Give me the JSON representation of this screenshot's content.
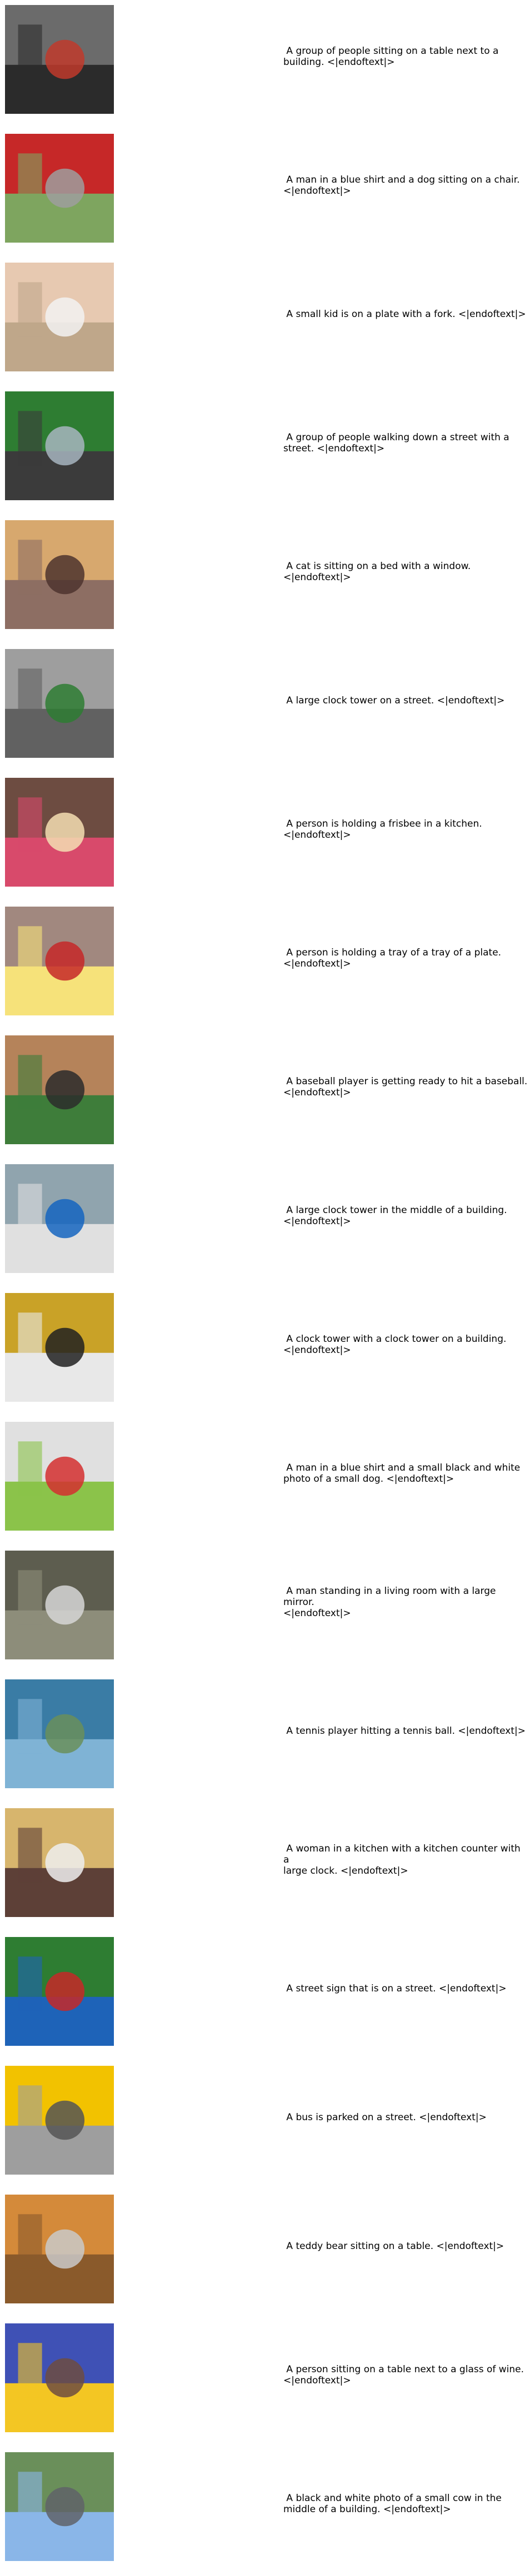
{
  "items": [
    {
      "caption": " A group of people sitting on a table next to a\nbuilding. <|endoftext|>",
      "photo": {
        "type": "image",
        "palette": [
          "#2b2b2b",
          "#6b6b6b",
          "#c0392b"
        ]
      }
    },
    {
      "caption": " A man in a blue shirt and a dog sitting on a chair.\n<|endoftext|>",
      "photo": {
        "type": "image",
        "palette": [
          "#7ea55f",
          "#c62828",
          "#9e9e9e"
        ]
      }
    },
    {
      "caption": " A small kid is on a plate with a fork. <|endoftext|>",
      "photo": {
        "type": "image",
        "palette": [
          "#bfa78a",
          "#e7c9b1",
          "#f2f2f2"
        ]
      }
    },
    {
      "caption": " A group of people walking down a street with a\nstreet. <|endoftext|>",
      "photo": {
        "type": "image",
        "palette": [
          "#3b3b3b",
          "#2e7d32",
          "#a7b5c0"
        ]
      }
    },
    {
      "caption": " A cat is sitting on a bed with a window.\n<|endoftext|>",
      "photo": {
        "type": "image",
        "palette": [
          "#8d6e63",
          "#d7a86e",
          "#4e342e"
        ]
      }
    },
    {
      "caption": " A large clock tower on a street. <|endoftext|>",
      "photo": {
        "type": "image",
        "palette": [
          "#616161",
          "#9e9e9e",
          "#2e7d32"
        ]
      }
    },
    {
      "caption": " A person is holding a frisbee in a kitchen.\n<|endoftext|>",
      "photo": {
        "type": "image",
        "palette": [
          "#d84a6b",
          "#6d4c41",
          "#f5deb3"
        ]
      }
    },
    {
      "caption": " A person is holding a tray of a tray of a plate.\n<|endoftext|>",
      "photo": {
        "type": "image",
        "palette": [
          "#f6e27a",
          "#a1887f",
          "#c62828"
        ]
      }
    },
    {
      "caption": " A baseball player is getting ready to hit a baseball.\n<|endoftext|>",
      "photo": {
        "type": "image",
        "palette": [
          "#3e7d3a",
          "#b5835a",
          "#2b2b2b"
        ]
      }
    },
    {
      "caption": " A large clock tower in the middle of a building.\n<|endoftext|>",
      "photo": {
        "type": "image",
        "palette": [
          "#e0e0e0",
          "#90a4ae",
          "#1565c0"
        ]
      }
    },
    {
      "caption": " A clock tower with a clock tower on a building.\n<|endoftext|>",
      "photo": {
        "type": "image",
        "palette": [
          "#e8e8e8",
          "#c9a227",
          "#212121"
        ]
      }
    },
    {
      "caption": " A man in a blue shirt and a small black and white\nphoto of a small dog. <|endoftext|>",
      "photo": {
        "type": "image",
        "palette": [
          "#8bc34a",
          "#e0e0e0",
          "#d32f2f"
        ]
      }
    },
    {
      "caption": " A man standing in a living room with a large mirror.\n<|endoftext|>",
      "photo": {
        "type": "image",
        "palette": [
          "#8d8d7a",
          "#5d5d4f",
          "#d6d6d6"
        ]
      }
    },
    {
      "caption": " A tennis player hitting a tennis ball. <|endoftext|>",
      "photo": {
        "type": "image",
        "palette": [
          "#7fb3d5",
          "#3a7ca5",
          "#6a8f5a"
        ]
      }
    },
    {
      "caption": " A woman in a kitchen with a kitchen counter with a\nlarge clock. <|endoftext|>",
      "photo": {
        "type": "image",
        "palette": [
          "#5d4037",
          "#d7b56d",
          "#eeeeee"
        ]
      }
    },
    {
      "caption": " A street sign that is on a street. <|endoftext|>",
      "photo": {
        "type": "image",
        "palette": [
          "#1e63b8",
          "#2e7d32",
          "#c62828"
        ]
      }
    },
    {
      "caption": " A bus is parked on a street. <|endoftext|>",
      "photo": {
        "type": "image",
        "palette": [
          "#9e9e9e",
          "#f2c200",
          "#555555"
        ]
      }
    },
    {
      "caption": " A teddy bear sitting on a table. <|endoftext|>",
      "photo": {
        "type": "image",
        "palette": [
          "#8a5a2b",
          "#d48a3a",
          "#c9c9c9"
        ]
      }
    },
    {
      "caption": " A person sitting on a table next to a glass of wine.\n<|endoftext|>",
      "photo": {
        "type": "image",
        "palette": [
          "#f3c623",
          "#3f51b5",
          "#6d4c41"
        ]
      }
    },
    {
      "caption": " A black and white photo of a small cow in the\nmiddle of a building. <|endoftext|>",
      "photo": {
        "type": "image",
        "palette": [
          "#8ab6e8",
          "#6a8f5a",
          "#5f6368"
        ]
      }
    }
  ]
}
